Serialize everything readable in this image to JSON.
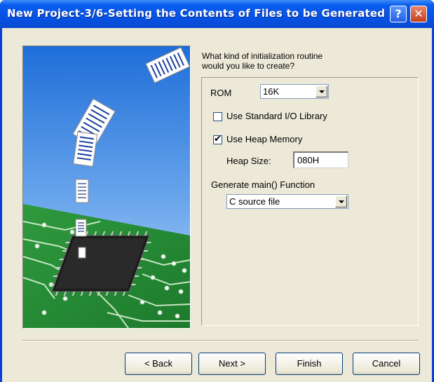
{
  "window": {
    "title": "New Project-3/6-Setting the Contents of Files to be Generated",
    "help_glyph": "?",
    "close_glyph": "✕"
  },
  "prompt": {
    "line1": "What kind of initialization routine",
    "line2": "would you like to create?"
  },
  "rom": {
    "label": "ROM",
    "value": "16K"
  },
  "std_io": {
    "label": "Use Standard I/O Library",
    "checked": false
  },
  "heap": {
    "label": "Use Heap Memory",
    "checked": true,
    "check_glyph": "✔",
    "size_label": "Heap Size:",
    "size_value": "080H"
  },
  "main_func": {
    "label": "Generate main() Function",
    "value": "C source file"
  },
  "buttons": {
    "back": "< Back",
    "next": "Next >",
    "finish": "Finish",
    "cancel": "Cancel"
  }
}
